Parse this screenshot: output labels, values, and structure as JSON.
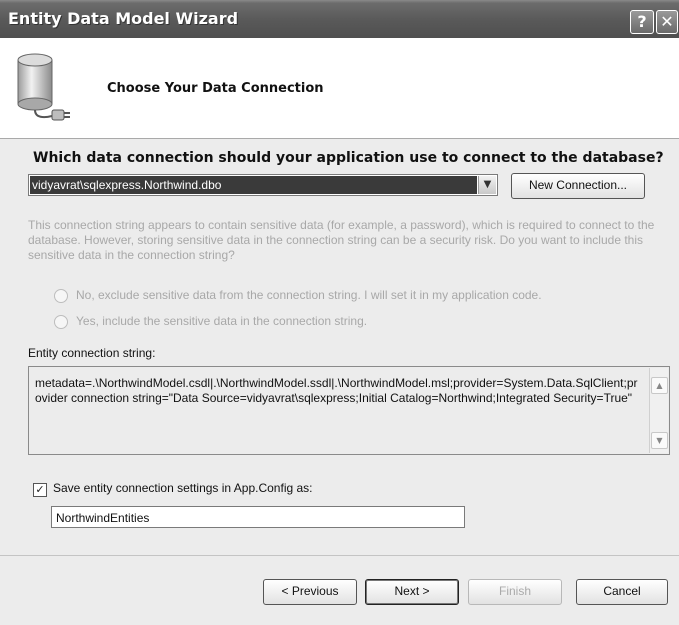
{
  "window": {
    "title": "Entity Data Model Wizard",
    "help_glyph": "?",
    "close_glyph": "✕"
  },
  "header": {
    "title": "Choose Your Data Connection",
    "icon": "database-connection-icon"
  },
  "question": "Which data connection should your application use to connect to the database?",
  "connection": {
    "selected": "vidyavrat\\sqlexpress.Northwind.dbo",
    "new_connection_label": "New Connection..."
  },
  "sensitive": {
    "text": "This connection string appears to contain sensitive data (for example, a password), which is required to connect to the database.  However, storing sensitive data in the connection string can be a security risk. Do you want to include this sensitive data in the connection string?",
    "option_no": "No, exclude sensitive data from the connection string. I will set it in my application code.",
    "option_yes": "Yes, include the sensitive data in the connection string."
  },
  "entity_connection": {
    "label": "Entity connection string:",
    "value": "metadata=.\\NorthwindModel.csdl|.\\NorthwindModel.ssdl|.\\NorthwindModel.msl;provider=System.Data.SqlClient;provider connection string=\"Data Source=vidyavrat\\sqlexpress;Initial Catalog=Northwind;Integrated Security=True\""
  },
  "save_settings": {
    "checked": true,
    "label": "Save entity connection settings in App.Config as:",
    "value": "NorthwindEntities"
  },
  "buttons": {
    "previous": "< Previous",
    "next": "Next >",
    "finish": "Finish",
    "cancel": "Cancel"
  }
}
